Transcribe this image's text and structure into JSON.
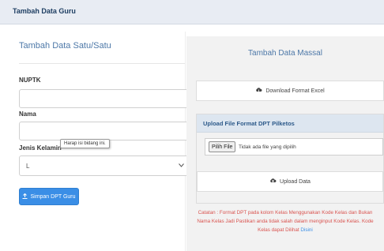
{
  "header": {
    "title": "Tambah Data Guru"
  },
  "left": {
    "title": "Tambah Data Satu/Satu",
    "nuptk_label": "NUPTK",
    "nama_label": "Nama",
    "tooltip": "Harap isi bidang ini.",
    "jenis_kelamin_label": "Jenis Kelamin",
    "jenis_kelamin_value": "L",
    "save_button": "Simpan DPT Guru"
  },
  "right": {
    "title": "Tambah Data Massal",
    "download_button": "Download Format Excel",
    "upload_header": "Upload File Format DPT Pilketos",
    "file_button": "Pilih File",
    "file_status": "Tidak ada file yang dipilih",
    "upload_button": "Upload Data",
    "note_line1": "Catatan : Format DPT pada kolom Kelas Menggunakan Kode Kelas dan Bukan",
    "note_line2": "Nama Kelas Jadi Pastikan anda tidak salah dalam menginput Kode Kelas. Kode",
    "note_line3_prefix": "Kelas dapat Dilihat",
    "note_link": "Disini"
  },
  "icons": {
    "save": "upload-icon",
    "download": "cloud-download-icon",
    "upload": "cloud-upload-icon",
    "select": "chevron-down-icon"
  },
  "colors": {
    "primary": "#3a8ee6",
    "note": "#d9534f",
    "heading": "#4d78a8"
  }
}
